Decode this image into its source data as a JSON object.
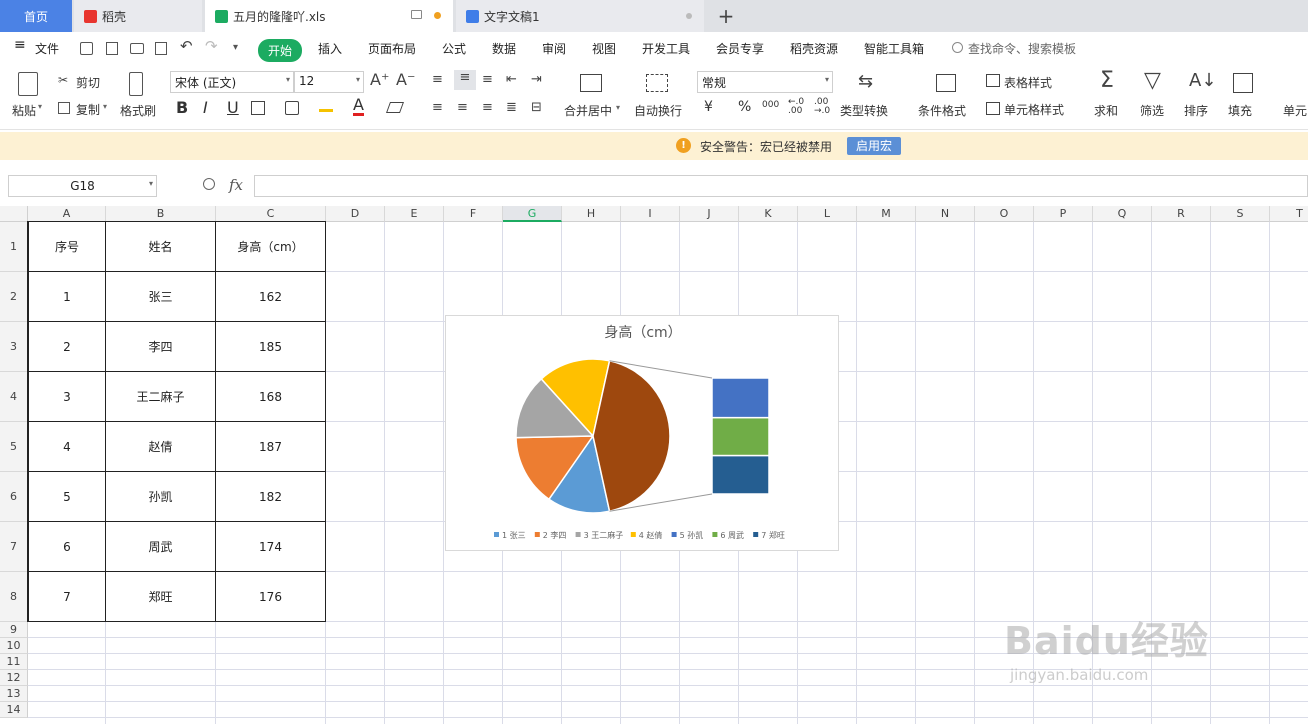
{
  "tabs": {
    "home": "首页",
    "daoke": "稻壳",
    "xls": "五月的隆隆吖.xls",
    "doc": "文字文稿1",
    "add": "+"
  },
  "menu": {
    "file": "文件",
    "start": "开始",
    "insert": "插入",
    "layout": "页面布局",
    "formula": "公式",
    "data": "数据",
    "review": "审阅",
    "view": "视图",
    "dev": "开发工具",
    "member": "会员专享",
    "daoke_res": "稻壳资源",
    "smart": "智能工具箱",
    "search": "查找命令、搜索模板"
  },
  "ribbon": {
    "paste": "粘贴",
    "cut": "剪切",
    "copy": "复制",
    "format_painter": "格式刷",
    "font_name": "宋体 (正文)",
    "font_size": "12",
    "bold": "B",
    "italic": "I",
    "underline": "U",
    "merge": "合并居中",
    "wrap": "自动换行",
    "number_format": "常规",
    "currency": "¥",
    "percent": "%",
    "thousands": "000",
    "type_convert": "类型转换",
    "cond_format": "条件格式",
    "table_style": "表格样式",
    "cell_style": "单元格样式",
    "sum": "求和",
    "filter": "筛选",
    "sort": "排序",
    "fill": "填充",
    "cell": "单元"
  },
  "warning": {
    "text": "安全警告：宏已经被禁用",
    "button": "启用宏"
  },
  "formula_bar": {
    "name_box": "G18",
    "fx": "fx",
    "value": ""
  },
  "columns": [
    "A",
    "B",
    "C",
    "D",
    "E",
    "F",
    "G",
    "H",
    "I",
    "J",
    "K",
    "L",
    "M",
    "N",
    "O",
    "P",
    "Q",
    "R",
    "S",
    "T"
  ],
  "rows": [
    "1",
    "2",
    "3",
    "4",
    "5",
    "6",
    "7",
    "8",
    "9",
    "10",
    "11",
    "12",
    "13",
    "14"
  ],
  "table": {
    "headers": [
      "序号",
      "姓名",
      "身高（cm）"
    ],
    "rows": [
      [
        "1",
        "张三",
        "162"
      ],
      [
        "2",
        "李四",
        "185"
      ],
      [
        "3",
        "王二麻子",
        "168"
      ],
      [
        "4",
        "赵倩",
        "187"
      ],
      [
        "5",
        "孙凯",
        "182"
      ],
      [
        "6",
        "周武",
        "174"
      ],
      [
        "7",
        "郑旺",
        "176"
      ]
    ]
  },
  "chart_data": {
    "type": "pie",
    "subtype": "bar-of-pie",
    "title": "身高（cm）",
    "categories": [
      "1 张三",
      "2 李四",
      "3 王二麻子",
      "4 赵倩",
      "5 孙凯",
      "6 周武",
      "7 郑旺"
    ],
    "values": [
      162,
      185,
      168,
      187,
      182,
      174,
      176
    ],
    "secondary_bar_categories": [
      "5 孙凯",
      "6 周武",
      "7 郑旺"
    ],
    "colors": [
      "#5b9bd5",
      "#ed7d31",
      "#a5a5a5",
      "#ffc000",
      "#4472c4",
      "#70ad47",
      "#255e91"
    ],
    "other_color": "#9e480e",
    "legend": "bottom"
  },
  "watermark": {
    "brand": "Baidu经验",
    "url": "jingyan.baidu.com"
  }
}
